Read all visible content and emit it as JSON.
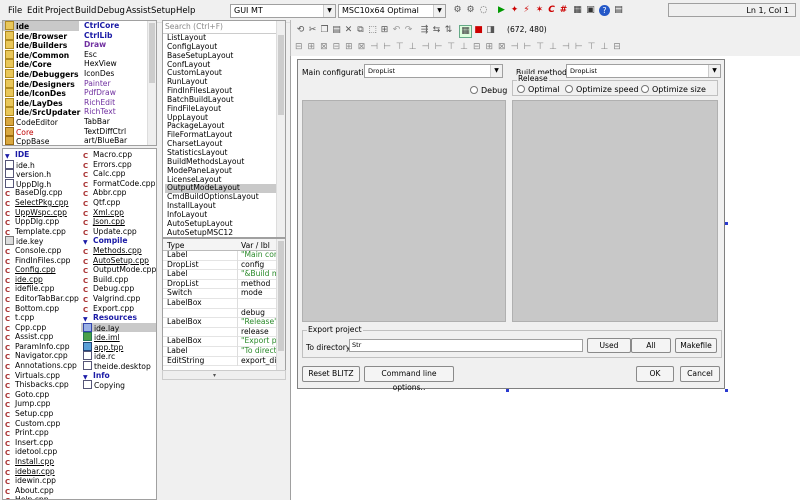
{
  "menu": [
    "File",
    "Edit",
    "Project",
    "Build",
    "Debug",
    "Assist",
    "Setup",
    "Help"
  ],
  "toolbar": {
    "package_combo": "GUI MT",
    "config_combo": "MSC10x64 Optimal",
    "coords": "(672, 480)",
    "status": "Ln 1, Col 1"
  },
  "packages_left": [
    {
      "label": "ide",
      "cls": "bold",
      "icon": "folder",
      "selected": true
    },
    {
      "label": "ide/Browser",
      "cls": "bold",
      "icon": "folder"
    },
    {
      "label": "ide/Builders",
      "cls": "bold",
      "icon": "folder"
    },
    {
      "label": "ide/Common",
      "cls": "bold",
      "icon": "folder"
    },
    {
      "label": "ide/Core",
      "cls": "bold",
      "icon": "folder"
    },
    {
      "label": "ide/Debuggers",
      "cls": "bold",
      "icon": "folder"
    },
    {
      "label": "ide/Designers",
      "cls": "bold",
      "icon": "folder"
    },
    {
      "label": "ide/IconDes",
      "cls": "bold",
      "icon": "folder"
    },
    {
      "label": "ide/LayDes",
      "cls": "bold",
      "icon": "folder"
    },
    {
      "label": "ide/SrcUpdater",
      "cls": "bold",
      "icon": "folder"
    },
    {
      "label": "CodeEditor",
      "cls": "",
      "icon": "pkg"
    },
    {
      "label": "Core",
      "cls": "red",
      "icon": "pkg"
    },
    {
      "label": "CppBase",
      "cls": "",
      "icon": "pkg"
    }
  ],
  "packages_right": [
    {
      "label": "CtrlCore",
      "cls": "bold blue"
    },
    {
      "label": "CtrlLib",
      "cls": "bold blue"
    },
    {
      "label": "Draw",
      "cls": "bold purple"
    },
    {
      "label": "Esc",
      "cls": ""
    },
    {
      "label": "HexView",
      "cls": ""
    },
    {
      "label": "IconDes",
      "cls": ""
    },
    {
      "label": "Painter",
      "cls": "purple"
    },
    {
      "label": "PdfDraw",
      "cls": "purple"
    },
    {
      "label": "RichEdit",
      "cls": "purple"
    },
    {
      "label": "RichText",
      "cls": "purple"
    },
    {
      "label": "TabBar",
      "cls": ""
    },
    {
      "label": "TextDiffCtrl",
      "cls": ""
    },
    {
      "label": "art/BlueBar",
      "cls": ""
    }
  ],
  "files_left": [
    {
      "label": "IDE",
      "cls": "bold blue",
      "icon": "tri"
    },
    {
      "label": "ide.h",
      "cls": "",
      "icon": "h"
    },
    {
      "label": "version.h",
      "cls": "",
      "icon": "h"
    },
    {
      "label": "UppDlg.h",
      "cls": "",
      "icon": "h"
    },
    {
      "label": "BaseDlg.cpp",
      "cls": "",
      "icon": "c"
    },
    {
      "label": "SelectPkg.cpp",
      "cls": "under",
      "icon": "c"
    },
    {
      "label": "UppWspc.cpp",
      "cls": "under",
      "icon": "c"
    },
    {
      "label": "UppDlg.cpp",
      "cls": "",
      "icon": "c"
    },
    {
      "label": "Template.cpp",
      "cls": "",
      "icon": "c"
    },
    {
      "label": "ide.key",
      "cls": "",
      "icon": "k"
    },
    {
      "label": "Console.cpp",
      "cls": "",
      "icon": "c"
    },
    {
      "label": "FindInFiles.cpp",
      "cls": "",
      "icon": "c"
    },
    {
      "label": "Config.cpp",
      "cls": "under",
      "icon": "c"
    },
    {
      "label": "ide.cpp",
      "cls": "under",
      "icon": "c"
    },
    {
      "label": "idefile.cpp",
      "cls": "",
      "icon": "c"
    },
    {
      "label": "EditorTabBar.cpp",
      "cls": "",
      "icon": "c"
    },
    {
      "label": "Bottom.cpp",
      "cls": "",
      "icon": "c"
    },
    {
      "label": "t.cpp",
      "cls": "",
      "icon": "c"
    },
    {
      "label": "Cpp.cpp",
      "cls": "",
      "icon": "c"
    },
    {
      "label": "Assist.cpp",
      "cls": "",
      "icon": "c"
    },
    {
      "label": "ParamInfo.cpp",
      "cls": "",
      "icon": "c"
    },
    {
      "label": "Navigator.cpp",
      "cls": "",
      "icon": "c"
    },
    {
      "label": "Annotations.cpp",
      "cls": "",
      "icon": "c"
    },
    {
      "label": "Virtuals.cpp",
      "cls": "",
      "icon": "c"
    },
    {
      "label": "Thisbacks.cpp",
      "cls": "",
      "icon": "c"
    },
    {
      "label": "Goto.cpp",
      "cls": "",
      "icon": "c"
    },
    {
      "label": "Jump.cpp",
      "cls": "",
      "icon": "c"
    },
    {
      "label": "Setup.cpp",
      "cls": "",
      "icon": "c"
    },
    {
      "label": "Custom.cpp",
      "cls": "",
      "icon": "c"
    },
    {
      "label": "Print.cpp",
      "cls": "",
      "icon": "c"
    },
    {
      "label": "Insert.cpp",
      "cls": "",
      "icon": "c"
    },
    {
      "label": "idetool.cpp",
      "cls": "",
      "icon": "c"
    },
    {
      "label": "Install.cpp",
      "cls": "under",
      "icon": "c"
    },
    {
      "label": "idebar.cpp",
      "cls": "under",
      "icon": "c"
    },
    {
      "label": "idewin.cpp",
      "cls": "",
      "icon": "c"
    },
    {
      "label": "About.cpp",
      "cls": "",
      "icon": "c"
    },
    {
      "label": "Help.cpp",
      "cls": "",
      "icon": "c"
    }
  ],
  "files_right": [
    {
      "label": "Macro.cpp",
      "cls": "",
      "icon": "c"
    },
    {
      "label": "Errors.cpp",
      "cls": "",
      "icon": "c"
    },
    {
      "label": "Calc.cpp",
      "cls": "",
      "icon": "c"
    },
    {
      "label": "FormatCode.cpp",
      "cls": "",
      "icon": "c"
    },
    {
      "label": "Abbr.cpp",
      "cls": "",
      "icon": "c"
    },
    {
      "label": "Qtf.cpp",
      "cls": "",
      "icon": "c"
    },
    {
      "label": "Xml.cpp",
      "cls": "under",
      "icon": "c"
    },
    {
      "label": "Json.cpp",
      "cls": "under",
      "icon": "c"
    },
    {
      "label": "Update.cpp",
      "cls": "",
      "icon": "c"
    },
    {
      "label": "Compile",
      "cls": "bold blue",
      "icon": "tri"
    },
    {
      "label": "Methods.cpp",
      "cls": "under",
      "icon": "c"
    },
    {
      "label": "AutoSetup.cpp",
      "cls": "under",
      "icon": "c"
    },
    {
      "label": "OutputMode.cpp",
      "cls": "",
      "icon": "c"
    },
    {
      "label": "Build.cpp",
      "cls": "",
      "icon": "c"
    },
    {
      "label": "Debug.cpp",
      "cls": "",
      "icon": "c"
    },
    {
      "label": "Valgrind.cpp",
      "cls": "",
      "icon": "c"
    },
    {
      "label": "Export.cpp",
      "cls": "",
      "icon": "c"
    },
    {
      "label": "Resources",
      "cls": "bold blue",
      "icon": "tri"
    },
    {
      "label": "ide.lay",
      "cls": "",
      "icon": "lay",
      "selected": true
    },
    {
      "label": "ide.iml",
      "cls": "under",
      "icon": "iml"
    },
    {
      "label": "app.tpp",
      "cls": "under",
      "icon": "tpp"
    },
    {
      "label": "ide.rc",
      "cls": "",
      "icon": "h"
    },
    {
      "label": "theide.desktop",
      "cls": "",
      "icon": "h"
    },
    {
      "label": "Info",
      "cls": "bold blue",
      "icon": "tri"
    },
    {
      "label": "Copying",
      "cls": "",
      "icon": "h"
    }
  ],
  "search": {
    "placeholder": "Search (Ctrl+F)"
  },
  "layouts": [
    "ListLayout",
    "ConfigLayout",
    "BaseSetupLayout",
    "ConfLayout",
    "CustomLayout",
    "RunLayout",
    "FindInFilesLayout",
    "BatchBuildLayout",
    "FindFileLayout",
    "UppLayout",
    "PackageLayout",
    "FileFormatLayout",
    "CharsetLayout",
    "StatisticsLayout",
    "BuildMethodsLayout",
    "ModePaneLayout",
    "LicenseLayout",
    "OutputModeLayout",
    "CmdBuildOptionsLayout",
    "InstallLayout",
    "InfoLayout",
    "AutoSetupLayout",
    "AutoSetupMSC12"
  ],
  "layouts_selected": "OutputModeLayout",
  "items": {
    "headers": [
      "Type",
      "Var / lbl"
    ],
    "rows": [
      [
        "Label",
        "\"Main con"
      ],
      [
        "DropList",
        "config"
      ],
      [
        "Label",
        "\"&Build m"
      ],
      [
        "DropList",
        "method"
      ],
      [
        "Switch",
        "mode"
      ],
      [
        "LabelBox",
        ""
      ],
      [
        "",
        "debug"
      ],
      [
        "LabelBox",
        "\"Release\""
      ],
      [
        "",
        "release"
      ],
      [
        "LabelBox",
        "\"Export pr"
      ],
      [
        "Label",
        "\"To direct"
      ],
      [
        "EditString",
        "export_dir"
      ]
    ]
  },
  "dialog": {
    "main_config_label": "Main configuration",
    "main_config_value": "DropList",
    "build_method_label": "Build method",
    "build_method_value": "DropList",
    "debug_label": "Debug",
    "release_label": "Release",
    "optimal_label": "Optimal",
    "optimize_speed_label": "Optimize speed",
    "optimize_size_label": "Optimize size",
    "export_project_label": "Export project",
    "to_directory_label": "To directory",
    "to_directory_value": "Str",
    "used_button": "Used",
    "all_button": "All",
    "makefile_button": "Makefile",
    "reset_blitz_button": "Reset BLITZ",
    "cmdline_button": "Command line options..",
    "ok_button": "OK",
    "cancel_button": "Cancel"
  },
  "colors": {
    "selection": "#c9c9c9",
    "link_blue": "#1a1aa6",
    "handle": "#2a3ad0"
  }
}
